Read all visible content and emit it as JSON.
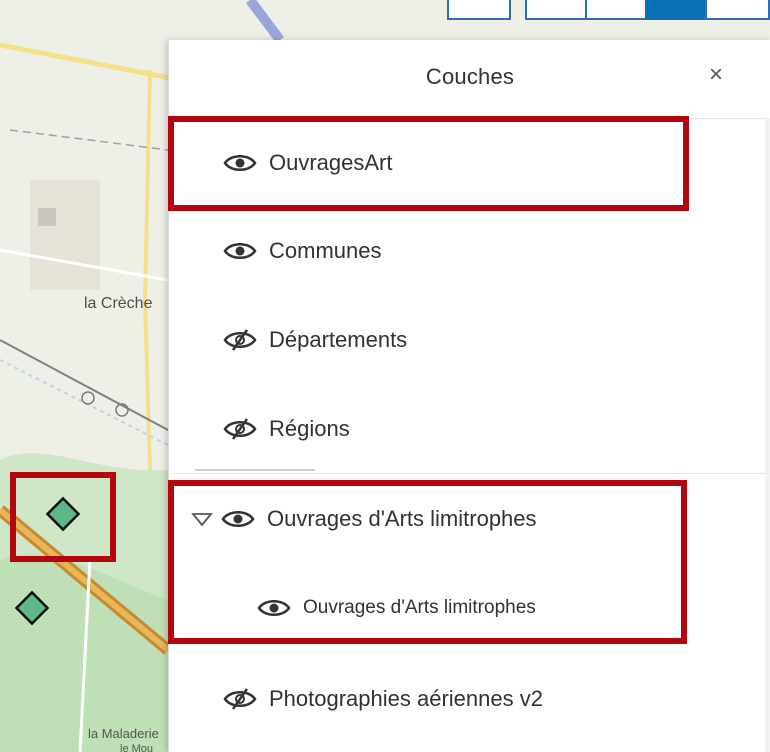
{
  "panel": {
    "title": "Couches",
    "close_glyph": "×",
    "layers": [
      {
        "label": "OuvragesArt",
        "visible": true,
        "icon": "eye-icon"
      },
      {
        "label": "Communes",
        "visible": true,
        "icon": "eye-icon"
      },
      {
        "label": "Départements",
        "visible": false,
        "icon": "eye-slash-icon"
      },
      {
        "label": "Régions",
        "visible": false,
        "icon": "eye-slash-icon"
      },
      {
        "label": "Ouvrages d'Arts limitrophes",
        "visible": true,
        "icon": "eye-icon",
        "expanded": true
      },
      {
        "label": "Ouvrages d'Arts limitrophes",
        "visible": true,
        "icon": "eye-icon",
        "sublayer": true
      },
      {
        "label": "Photographies aériennes v2",
        "visible": false,
        "icon": "eye-slash-icon"
      }
    ]
  },
  "map": {
    "labels": {
      "town_1": "la Crèche",
      "town_2": "la Maladerie",
      "town_3": "le Mou"
    }
  },
  "colors": {
    "highlight": "#b3060f",
    "accent": "#0a71b9",
    "marker": "#5cb889"
  }
}
